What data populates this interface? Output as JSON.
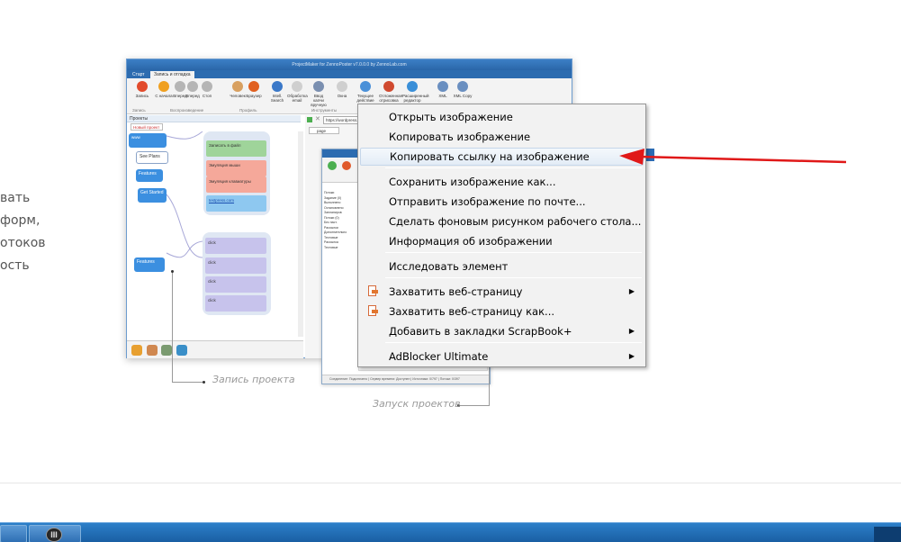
{
  "left_text": [
    "вать",
    "форм,",
    "отоков",
    "ость"
  ],
  "app": {
    "title": "ProjectMaker for ZennoPoster v7.0.0.0 by ZennoLab.com",
    "tabs": [
      "Старт",
      "Запись и отладка"
    ],
    "ribbon": [
      {
        "label": "Запись",
        "color": "#e24b2c"
      },
      {
        "label": "С начала",
        "color": "#f0a020"
      },
      {
        "label": "Вперед",
        "color": "#b5b5b5"
      },
      {
        "label": "Вперед",
        "color": "#b5b5b5"
      },
      {
        "label": "Стоп",
        "color": "#b5b5b5"
      },
      {
        "label": "Человек",
        "color": "#d8a060"
      },
      {
        "label": "Браузер",
        "color": "#e06020"
      },
      {
        "label": "Intell. Search",
        "color": "#3a78c8"
      },
      {
        "label": "Обработка email",
        "color": "#cfcfcf"
      },
      {
        "label": "Ввод капчи вручную",
        "color": "#7a8fb0"
      },
      {
        "label": "Окна",
        "color": "#cfcfcf"
      },
      {
        "label": "Текущее действие",
        "color": "#4a90d8"
      },
      {
        "label": "Отложенная отрисовка",
        "color": "#d04a30"
      },
      {
        "label": "Расширенный редактор",
        "color": "#3a8fd8"
      },
      {
        "label": "XML",
        "color": "#6a8fc0"
      },
      {
        "label": "XML Copy",
        "color": "#6a8fc0"
      }
    ],
    "groups": [
      "Запись",
      "Воспроизведение",
      "Профиль",
      "Инструменты"
    ],
    "projects_label": "Проекты",
    "project_tab": "Новый проект",
    "address": "https://wordpress...",
    "page_tab": "page",
    "nodes": [
      "See Plans",
      "Features",
      "Get Started",
      "Features"
    ],
    "cards": [
      "Записать в файл",
      "Эмуляция мыши",
      "Эмуляция клавиатуры",
      "testpress.com"
    ],
    "clicks": [
      "click",
      "click",
      "click",
      "click"
    ]
  },
  "inner": {
    "list": [
      "Потоки",
      "Задание (0)",
      "Выполнено",
      "Остановлено",
      "Запланиров",
      "Потоки (0)",
      "Без наст.",
      "Рассылки",
      "Дополнительно",
      "Тестовые",
      "Рассылка",
      "Тестовые"
    ],
    "status": "Соединение: Подключено | Сервер времени: Доступен | Источники: 0/797 | Потоки: 0/397"
  },
  "captions": {
    "record": "Запись проекта",
    "launch": "Запуск проектов"
  },
  "context_menu": {
    "items": [
      {
        "label": "Открыть изображение",
        "arrow": false,
        "icon": false
      },
      {
        "label": "Копировать изображение",
        "arrow": false,
        "icon": false
      },
      {
        "label": "Копировать ссылку на изображение",
        "arrow": false,
        "icon": false,
        "highlighted": true
      },
      {
        "label": "Сохранить изображение как...",
        "arrow": false,
        "icon": false
      },
      {
        "label": "Отправить изображение по почте...",
        "arrow": false,
        "icon": false
      },
      {
        "label": "Сделать фоновым рисунком рабочего стола...",
        "arrow": false,
        "icon": false
      },
      {
        "label": "Информация об изображении",
        "arrow": false,
        "icon": false
      },
      {
        "label": "Исследовать элемент",
        "arrow": false,
        "icon": false
      },
      {
        "label": "Захватить веб-страницу",
        "arrow": true,
        "icon": true
      },
      {
        "label": "Захватить веб-страницу как...",
        "arrow": false,
        "icon": true
      },
      {
        "label": "Добавить в закладки ScrapBook+",
        "arrow": true,
        "icon": false
      },
      {
        "label": "AdBlocker Ultimate",
        "arrow": true,
        "icon": false
      }
    ]
  },
  "colors": {
    "arrow": "#e01818",
    "taskbar": "#1f68b0",
    "menu_bg": "#f2f2f2"
  }
}
